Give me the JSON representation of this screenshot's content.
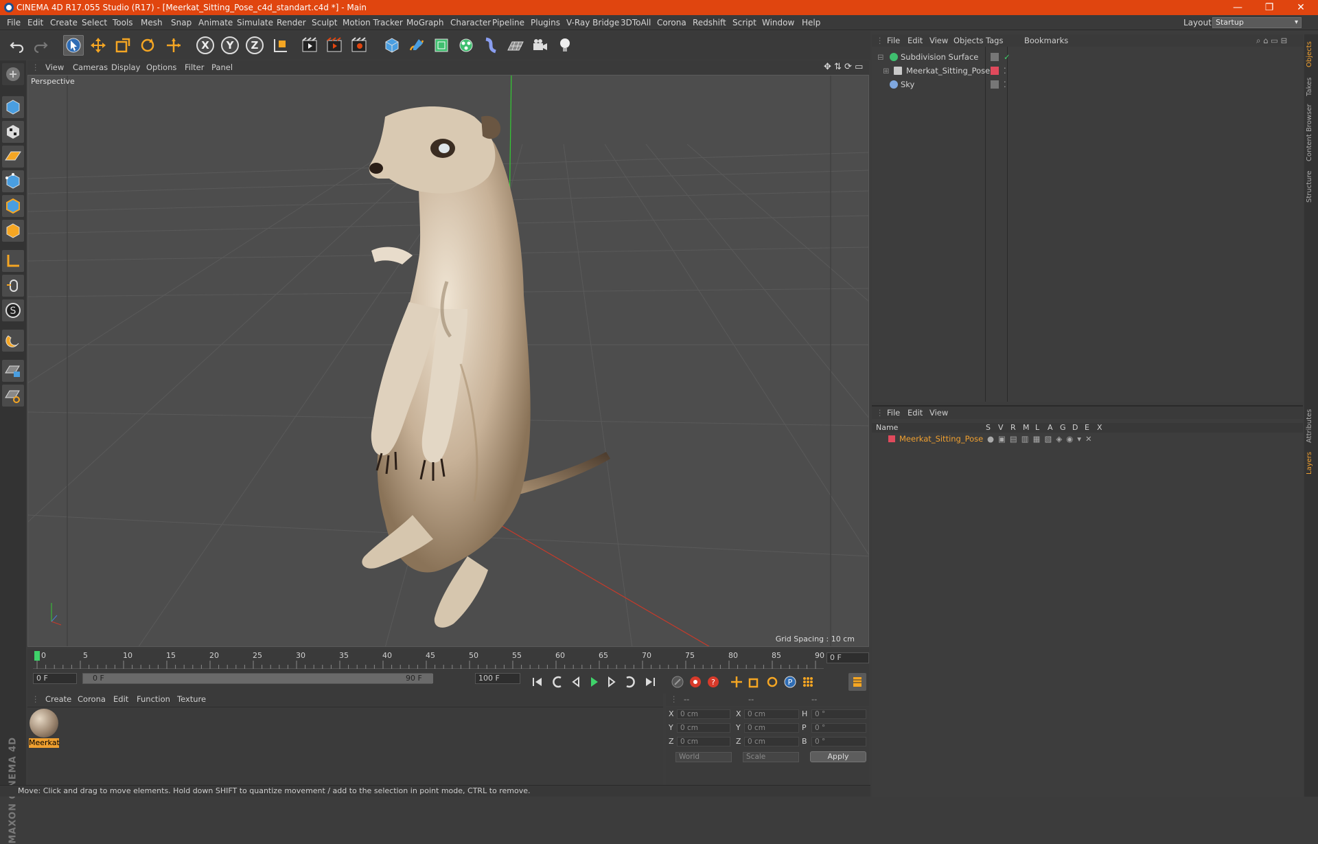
{
  "titlebar": {
    "title": "CINEMA 4D R17.055 Studio (R17) - [Meerkat_Sitting_Pose_c4d_standart.c4d *] - Main",
    "minimize": "—",
    "restore": "❐",
    "close": "✕"
  },
  "menubar": {
    "items": [
      "File",
      "Edit",
      "Create",
      "Select",
      "Tools",
      "Mesh",
      "Snap",
      "Animate",
      "Simulate",
      "Render",
      "Sculpt",
      "Motion Tracker",
      "MoGraph",
      "Character",
      "Pipeline",
      "Plugins",
      "V-Ray Bridge",
      "3DToAll",
      "Corona",
      "Redshift",
      "Script",
      "Window",
      "Help"
    ],
    "layout_label": "Layout:",
    "layout_value": "Startup"
  },
  "toolbar": {
    "axis_x": "X",
    "axis_y": "Y",
    "axis_z": "Z"
  },
  "viewport": {
    "menu": [
      "View",
      "Cameras",
      "Display",
      "Options",
      "Filter",
      "Panel"
    ],
    "label": "Perspective",
    "grid_spacing": "Grid Spacing : 10 cm"
  },
  "timeline": {
    "ticks": [
      "0",
      "5",
      "10",
      "15",
      "20",
      "25",
      "30",
      "35",
      "40",
      "45",
      "50",
      "55",
      "60",
      "65",
      "70",
      "75",
      "80",
      "85",
      "90"
    ],
    "current_frame": "0 F",
    "start_field": "0 F",
    "range_start": "0 F",
    "range_end": "90 F",
    "end_field": "100 F"
  },
  "materials": {
    "menu": [
      "Create",
      "Corona",
      "Edit",
      "Function",
      "Texture"
    ],
    "items": [
      {
        "label": "Meerkat"
      }
    ]
  },
  "coordinates": {
    "header": [
      "--",
      "--",
      "--"
    ],
    "rows": [
      {
        "a": "X",
        "a_val": "0 cm",
        "b": "X",
        "b_val": "0 cm",
        "c": "H",
        "c_val": "0 °"
      },
      {
        "a": "Y",
        "a_val": "0 cm",
        "b": "Y",
        "b_val": "0 cm",
        "c": "P",
        "c_val": "0 °"
      },
      {
        "a": "Z",
        "a_val": "0 cm",
        "b": "Z",
        "b_val": "0 cm",
        "c": "B",
        "c_val": "0 °"
      }
    ],
    "mode": "World",
    "mode2": "Scale",
    "apply": "Apply"
  },
  "status": "Move: Click and drag to move elements. Hold down SHIFT to quantize movement / add to the selection in point mode, CTRL to remove.",
  "objects": {
    "menu": [
      "File",
      "Edit",
      "View",
      "Objects",
      "Tags",
      "Bookmarks"
    ],
    "items": [
      {
        "name": "Subdivision Surface",
        "color": "#3fbf6f"
      },
      {
        "name": "Meerkat_Sitting_Pose",
        "color": "#c9c9c9"
      },
      {
        "name": "Sky",
        "color": "#7fa8e0"
      }
    ]
  },
  "layers": {
    "menu": [
      "File",
      "Edit",
      "View"
    ],
    "columns": [
      "Name",
      "S",
      "V",
      "R",
      "M",
      "L",
      "A",
      "G",
      "D",
      "E",
      "X"
    ],
    "items": [
      {
        "name": "Meerkat_Sitting_Pose",
        "color": "#e04a5c"
      }
    ]
  },
  "sidetabs": [
    "Objects",
    "Takes",
    "Content Browser",
    "Structure",
    "Attributes",
    "Layers"
  ],
  "brand": "MAXON CINEMA 4D",
  "colors": {
    "accent": "#e0450f",
    "highlight": "#f0a030"
  }
}
